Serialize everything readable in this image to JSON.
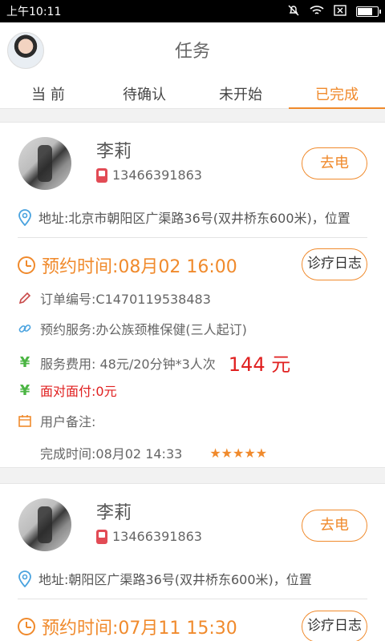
{
  "status_bar": {
    "time": "上午10:11"
  },
  "header": {
    "title": "任务"
  },
  "tabs": [
    {
      "label": "当 前"
    },
    {
      "label": "待确认"
    },
    {
      "label": "未开始"
    },
    {
      "label": "已完成"
    }
  ],
  "colors": {
    "accent": "#f08a2c",
    "price": "#e02020",
    "yen": "#4bb543"
  },
  "orders": [
    {
      "name": "李莉",
      "phone": "13466391863",
      "call_label": "去电",
      "address": "地址:北京市朝阳区广渠路36号(双井桥东600米)，位置",
      "appointment": "预约时间:08月02 16:00",
      "log_label": "诊疗日志",
      "order_no": "订单编号:C1470119538483",
      "service": "预约服务:办公族颈椎保健(三人起订)",
      "fee": "服务费用:  48元/20分钟*3人次",
      "price": "144 元",
      "f2f": "面对面付:0元",
      "remark": "用户备注:",
      "finish_time": "完成时间:08月02 14:33",
      "stars": "★★★★★"
    },
    {
      "name": "李莉",
      "phone": "13466391863",
      "call_label": "去电",
      "address": "地址:朝阳区广渠路36号(双井桥东600米)，位置",
      "appointment": "预约时间:07月11 15:30",
      "log_label": "诊疗日志"
    }
  ]
}
